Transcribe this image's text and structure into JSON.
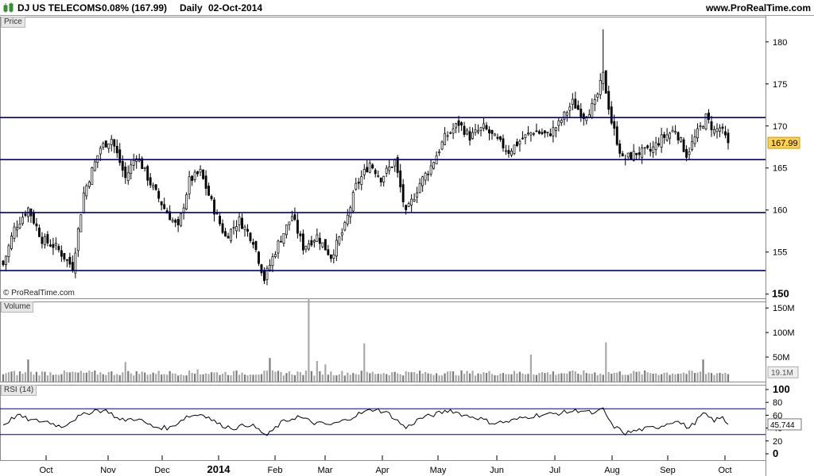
{
  "header": {
    "instrument": "DJ US TELECOMS",
    "change": "-0.08% (167.99)",
    "period": "Daily",
    "date": "02-Oct-2014",
    "source": "www.ProRealTime.com"
  },
  "panels": {
    "price_label": "Price",
    "volume_label": "Volume",
    "rsi_label": "RSI (14)",
    "watermark": "© ProRealTime.com"
  },
  "colors": {
    "candle_body_up": "#ffffff",
    "candle_body_down": "#000000",
    "support_line": "#000080",
    "volume_bar": "#a8a8a8",
    "rsi_line": "#000000",
    "rsi_level_line": "#000080",
    "price_marker_bg": "#ffd24d"
  },
  "chart_data": [
    {
      "type": "candlestick",
      "title": "DJ US TELECOMS",
      "x_tick_labels": [
        "Oct",
        "Nov",
        "Dec",
        "2014",
        "Feb",
        "Mar",
        "Apr",
        "May",
        "Jun",
        "Jul",
        "Aug",
        "Sep",
        "Oct"
      ],
      "y_ticks": [
        150,
        155,
        160,
        165,
        170,
        175,
        180
      ],
      "ylim": [
        149.5,
        183
      ],
      "last_price_label": "167.99",
      "horizontal_levels": [
        152.8,
        159.7,
        166.0,
        171.0
      ],
      "close_anchors": [
        {
          "day": 0,
          "close": 153.5
        },
        {
          "day": 4,
          "close": 157.8
        },
        {
          "day": 9,
          "close": 160.2
        },
        {
          "day": 14,
          "close": 156.5
        },
        {
          "day": 19,
          "close": 155.6
        },
        {
          "day": 25,
          "close": 153.2
        },
        {
          "day": 29,
          "close": 162.0
        },
        {
          "day": 35,
          "close": 167.4
        },
        {
          "day": 39,
          "close": 168.5
        },
        {
          "day": 44,
          "close": 163.8
        },
        {
          "day": 48,
          "close": 166.6
        },
        {
          "day": 53,
          "close": 163.2
        },
        {
          "day": 58,
          "close": 160.2
        },
        {
          "day": 63,
          "close": 157.8
        },
        {
          "day": 67,
          "close": 163.5
        },
        {
          "day": 71,
          "close": 164.5
        },
        {
          "day": 76,
          "close": 160.0
        },
        {
          "day": 80,
          "close": 156.8
        },
        {
          "day": 85,
          "close": 158.8
        },
        {
          "day": 90,
          "close": 156.4
        },
        {
          "day": 94,
          "close": 151.8
        },
        {
          "day": 99,
          "close": 156.0
        },
        {
          "day": 104,
          "close": 159.3
        },
        {
          "day": 108,
          "close": 155.6
        },
        {
          "day": 113,
          "close": 156.9
        },
        {
          "day": 118,
          "close": 154.5
        },
        {
          "day": 123,
          "close": 158.0
        },
        {
          "day": 127,
          "close": 162.8
        },
        {
          "day": 132,
          "close": 165.6
        },
        {
          "day": 136,
          "close": 163.8
        },
        {
          "day": 141,
          "close": 165.8
        },
        {
          "day": 145,
          "close": 159.5
        },
        {
          "day": 150,
          "close": 163.2
        },
        {
          "day": 154,
          "close": 165.2
        },
        {
          "day": 159,
          "close": 168.6
        },
        {
          "day": 164,
          "close": 170.3
        },
        {
          "day": 168,
          "close": 168.7
        },
        {
          "day": 173,
          "close": 169.8
        },
        {
          "day": 178,
          "close": 168.2
        },
        {
          "day": 182,
          "close": 167.0
        },
        {
          "day": 187,
          "close": 168.5
        },
        {
          "day": 191,
          "close": 169.4
        },
        {
          "day": 196,
          "close": 168.9
        },
        {
          "day": 200,
          "close": 170.2
        },
        {
          "day": 205,
          "close": 172.8
        },
        {
          "day": 209,
          "close": 171.2
        },
        {
          "day": 213,
          "close": 172.6
        },
        {
          "day": 216,
          "close": 176.0
        },
        {
          "day": 219,
          "close": 170.5
        },
        {
          "day": 223,
          "close": 166.0
        },
        {
          "day": 228,
          "close": 166.8
        },
        {
          "day": 233,
          "close": 167.0
        },
        {
          "day": 237,
          "close": 168.5
        },
        {
          "day": 242,
          "close": 169.6
        },
        {
          "day": 246,
          "close": 166.6
        },
        {
          "day": 250,
          "close": 169.2
        },
        {
          "day": 253,
          "close": 171.0
        },
        {
          "day": 256,
          "close": 169.4
        },
        {
          "day": 258,
          "close": 169.8
        },
        {
          "day": 261,
          "close": 167.99
        }
      ]
    },
    {
      "type": "bar",
      "title": "Volume",
      "y_ticks": [
        "50M",
        "100M",
        "150M"
      ],
      "ylim": [
        0,
        160000000
      ],
      "last_value_label": "19.1M",
      "typical_value": 19000000,
      "spikes": [
        {
          "day": 9,
          "value": 45000000
        },
        {
          "day": 44,
          "value": 40000000
        },
        {
          "day": 70,
          "value": 25000000
        },
        {
          "day": 96,
          "value": 48000000
        },
        {
          "day": 110,
          "value": 170000000
        },
        {
          "day": 113,
          "value": 42000000
        },
        {
          "day": 116,
          "value": 35000000
        },
        {
          "day": 130,
          "value": 78000000
        },
        {
          "day": 190,
          "value": 55000000
        },
        {
          "day": 217,
          "value": 80000000
        },
        {
          "day": 252,
          "value": 45000000
        }
      ]
    },
    {
      "type": "line",
      "title": "RSI (14)",
      "y_ticks": [
        0,
        20,
        40,
        60,
        80,
        100
      ],
      "ylim": [
        0,
        100
      ],
      "levels": [
        30,
        70
      ],
      "last_value_label": "45.744",
      "anchors": [
        {
          "day": 0,
          "value": 45
        },
        {
          "day": 5,
          "value": 60
        },
        {
          "day": 10,
          "value": 52
        },
        {
          "day": 16,
          "value": 50
        },
        {
          "day": 21,
          "value": 42
        },
        {
          "day": 26,
          "value": 55
        },
        {
          "day": 33,
          "value": 68
        },
        {
          "day": 38,
          "value": 66
        },
        {
          "day": 42,
          "value": 52
        },
        {
          "day": 48,
          "value": 55
        },
        {
          "day": 54,
          "value": 42
        },
        {
          "day": 60,
          "value": 40
        },
        {
          "day": 66,
          "value": 58
        },
        {
          "day": 72,
          "value": 62
        },
        {
          "day": 78,
          "value": 45
        },
        {
          "day": 83,
          "value": 40
        },
        {
          "day": 89,
          "value": 46
        },
        {
          "day": 95,
          "value": 28
        },
        {
          "day": 100,
          "value": 48
        },
        {
          "day": 106,
          "value": 58
        },
        {
          "day": 112,
          "value": 48
        },
        {
          "day": 118,
          "value": 45
        },
        {
          "day": 123,
          "value": 52
        },
        {
          "day": 128,
          "value": 62
        },
        {
          "day": 134,
          "value": 70
        },
        {
          "day": 139,
          "value": 62
        },
        {
          "day": 145,
          "value": 40
        },
        {
          "day": 150,
          "value": 55
        },
        {
          "day": 156,
          "value": 62
        },
        {
          "day": 161,
          "value": 68
        },
        {
          "day": 166,
          "value": 60
        },
        {
          "day": 171,
          "value": 56
        },
        {
          "day": 176,
          "value": 48
        },
        {
          "day": 182,
          "value": 50
        },
        {
          "day": 187,
          "value": 56
        },
        {
          "day": 192,
          "value": 60
        },
        {
          "day": 198,
          "value": 62
        },
        {
          "day": 203,
          "value": 65
        },
        {
          "day": 208,
          "value": 68
        },
        {
          "day": 213,
          "value": 62
        },
        {
          "day": 216,
          "value": 70
        },
        {
          "day": 219,
          "value": 45
        },
        {
          "day": 224,
          "value": 32
        },
        {
          "day": 230,
          "value": 38
        },
        {
          "day": 236,
          "value": 42
        },
        {
          "day": 242,
          "value": 52
        },
        {
          "day": 247,
          "value": 40
        },
        {
          "day": 252,
          "value": 62
        },
        {
          "day": 256,
          "value": 52
        },
        {
          "day": 259,
          "value": 56
        },
        {
          "day": 261,
          "value": 45.744
        }
      ]
    }
  ]
}
